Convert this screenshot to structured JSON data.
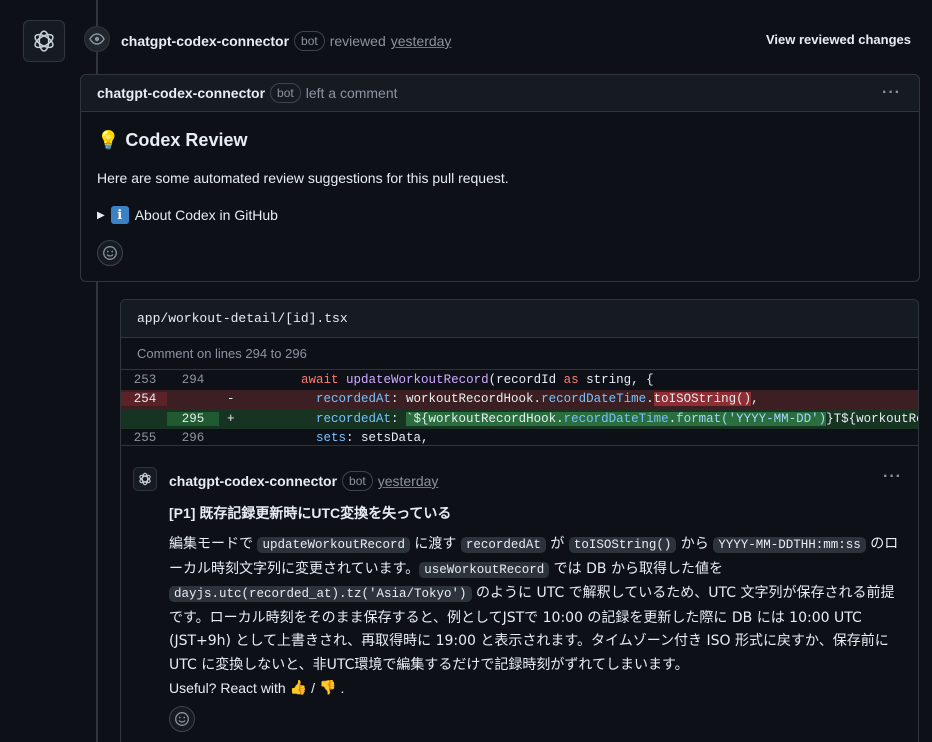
{
  "review": {
    "author": "chatgpt-codex-connector",
    "badge": "bot",
    "action": "reviewed",
    "time": "yesterday",
    "view_button": "View reviewed changes"
  },
  "comment": {
    "author": "chatgpt-codex-connector",
    "badge": "bot",
    "action": "left a comment",
    "more": "···",
    "heading_emoji": "💡",
    "heading": "Codex Review",
    "paragraph": "Here are some automated review suggestions for this pull request.",
    "details_arrow": "▶",
    "details_icon": "i",
    "details_label": "About Codex in GitHub"
  },
  "thread": {
    "file_path": "app/workout-detail/[id].tsx",
    "lines_note": "Comment on lines 294 to 296",
    "diff": [
      {
        "old": "253",
        "new": "294",
        "sign": "",
        "type": "ctx"
      },
      {
        "old": "254",
        "new": "",
        "sign": "-",
        "type": "del"
      },
      {
        "old": "",
        "new": "295",
        "sign": "+",
        "type": "add"
      },
      {
        "old": "255",
        "new": "296",
        "sign": "",
        "type": "ctx"
      }
    ],
    "code": {
      "l1_kw1": "await",
      "l1_fn": "updateWorkoutRecord",
      "l1_a": "(recordId ",
      "l1_kw2": "as",
      "l1_b": " string, {",
      "l2_prop": "recordedAt",
      "l2_a": ": workoutRecordHook.",
      "l2_prop2": "recordDateTime",
      "l2_dot": ".",
      "l2_hl": "toISOString()",
      "l2_end": ",",
      "l3_prop": "recordedAt",
      "l3_a": ": ",
      "l3_b": "`${workoutRecordHook.",
      "l3_prop2": "recordDateTime",
      "l3_dot": ".",
      "l3_hl": "format('YYYY-MM-DD')",
      "l3_c": "}T${workoutRecor",
      "l4_prop": "sets",
      "l4_a": ": setsData,"
    },
    "reply": {
      "author": "chatgpt-codex-connector",
      "badge": "bot",
      "time": "yesterday",
      "more": "···",
      "title": "[P1] 既存記録更新時にUTC変換を失っている",
      "t1": "編集モードで ",
      "c1": "updateWorkoutRecord",
      "t2": " に渡す ",
      "c2": "recordedAt",
      "t3": " が ",
      "c3": "toISOString()",
      "t4": " から ",
      "c4": "YYYY-MM-DDTHH:mm:ss",
      "t5": " のローカル時刻文字列に変更されています。",
      "c5": "useWorkoutRecord",
      "t6": " では DB から取得した値を ",
      "c6": "dayjs.utc(recorded_at).tz('Asia/Tokyo')",
      "t7": " のように UTC で解釈しているため、UTC 文字列が保存される前提です。ローカル時刻をそのまま保存すると、例としてJSTで 10:00 の記録を更新した際に DB には 10:00 UTC (JST+9h) として上書きされ、再取得時に 19:00 と表示されます。タイムゾーン付き ISO 形式に戻すか、保存前に UTC に変換しないと、非UTC環境で編集するだけで記録時刻がずれてしまいます。",
      "useful": "Useful? React with",
      "thumbs_up": "👍",
      "slash": "/",
      "thumbs_down": "👎",
      "period": "."
    }
  }
}
